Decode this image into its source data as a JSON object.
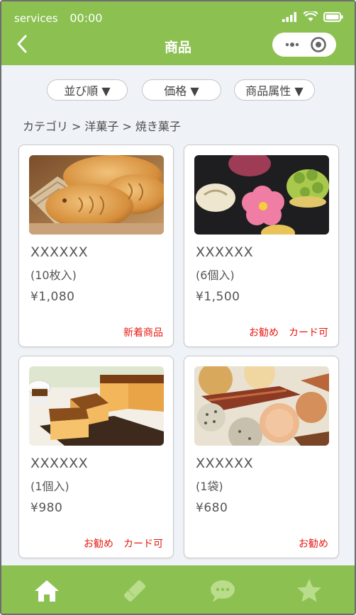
{
  "status": {
    "carrier": "services",
    "time": "00:00"
  },
  "header": {
    "title": "商品"
  },
  "filters": [
    {
      "label": "並び順 ▼"
    },
    {
      "label": "価格 ▼"
    },
    {
      "label": "商品属性 ▼"
    }
  ],
  "breadcrumb": {
    "items": [
      "カテゴリ",
      "洋菓子",
      "焼き菓子"
    ],
    "separator": ">"
  },
  "products": [
    {
      "name": "XXXXXX",
      "qty": "(10枚入)",
      "price": "¥1,080",
      "tags": [
        "新着商品"
      ]
    },
    {
      "name": "XXXXXX",
      "qty": "(6個入)",
      "price": "¥1,500",
      "tags": [
        "お勧め",
        "カード可"
      ]
    },
    {
      "name": "XXXXXX",
      "qty": "(1個入)",
      "price": "¥980",
      "tags": [
        "お勧め",
        "カード可"
      ]
    },
    {
      "name": "XXXXXX",
      "qty": "(1袋)",
      "price": "¥680",
      "tags": [
        "お勧め"
      ]
    }
  ],
  "nav": {
    "icons": [
      "home-icon",
      "ticket-icon",
      "chat-icon",
      "star-icon"
    ]
  },
  "colors": {
    "brand": "#8cc152",
    "tag": "#e8170f",
    "nav_icon": "#b9dd8a"
  }
}
